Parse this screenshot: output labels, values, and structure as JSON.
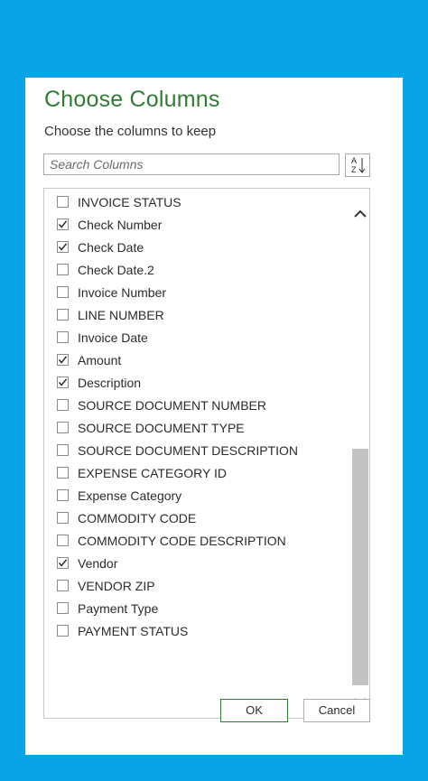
{
  "dialog": {
    "title": "Choose Columns",
    "subtitle": "Choose the columns to keep"
  },
  "search": {
    "placeholder": "Search Columns"
  },
  "columns": [
    {
      "label": "INVOICE STATUS",
      "checked": false
    },
    {
      "label": "Check Number",
      "checked": true
    },
    {
      "label": "Check Date",
      "checked": true
    },
    {
      "label": "Check Date.2",
      "checked": false
    },
    {
      "label": "Invoice Number",
      "checked": false
    },
    {
      "label": "LINE NUMBER",
      "checked": false
    },
    {
      "label": "Invoice Date",
      "checked": false
    },
    {
      "label": "Amount",
      "checked": true
    },
    {
      "label": "Description",
      "checked": true
    },
    {
      "label": "SOURCE DOCUMENT NUMBER",
      "checked": false
    },
    {
      "label": "SOURCE DOCUMENT TYPE",
      "checked": false
    },
    {
      "label": "SOURCE DOCUMENT DESCRIPTION",
      "checked": false
    },
    {
      "label": "EXPENSE CATEGORY ID",
      "checked": false
    },
    {
      "label": "Expense Category",
      "checked": false
    },
    {
      "label": "COMMODITY CODE",
      "checked": false
    },
    {
      "label": "COMMODITY CODE DESCRIPTION",
      "checked": false
    },
    {
      "label": "Vendor",
      "checked": true
    },
    {
      "label": "VENDOR ZIP",
      "checked": false
    },
    {
      "label": "Payment Type",
      "checked": false
    },
    {
      "label": "PAYMENT STATUS",
      "checked": false
    }
  ],
  "buttons": {
    "ok": "OK",
    "cancel": "Cancel"
  },
  "colors": {
    "background": "#0aa3e8",
    "title": "#2e7d32"
  },
  "icons": {
    "sort": "sort-az-icon",
    "scroll_up": "chevron-up-icon",
    "scroll_down": "chevron-down-icon"
  }
}
